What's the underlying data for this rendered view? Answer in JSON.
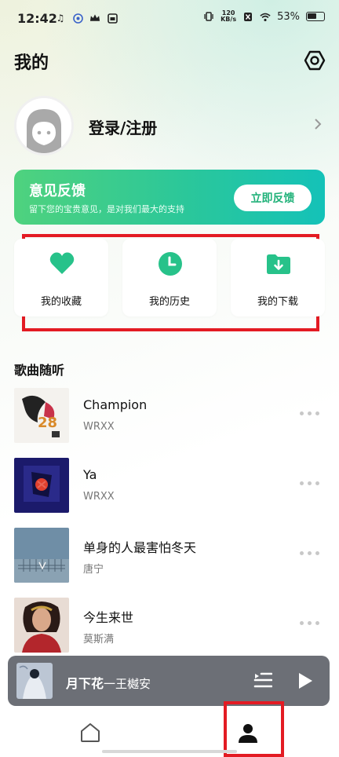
{
  "status_bar": {
    "time": "12:42",
    "net_speed_value": "120",
    "net_speed_unit": "KB/s",
    "battery": "53%",
    "icons_left": [
      "music-note-icon",
      "app-notification-icon",
      "crown-icon",
      "gallery-icon"
    ],
    "icons_right": [
      "vibrate-icon",
      "net-speed-icon",
      "no-sim-icon",
      "wifi-icon",
      "battery-icon"
    ]
  },
  "header": {
    "title": "我的",
    "settings_icon": "gear-icon"
  },
  "profile": {
    "login_label": "登录/注册"
  },
  "feedback": {
    "title": "意见反馈",
    "subtitle": "留下您的宝贵意见，是对我们最大的支持",
    "button_label": "立即反馈"
  },
  "quick_actions": [
    {
      "label": "我的收藏",
      "icon": "heart-icon"
    },
    {
      "label": "我的历史",
      "icon": "clock-icon"
    },
    {
      "label": "我的下载",
      "icon": "download-folder-icon"
    }
  ],
  "songs_section": {
    "title": "歌曲随听",
    "songs": [
      {
        "title": "Champion",
        "artist": "WRXX"
      },
      {
        "title": "Ya",
        "artist": "WRXX"
      },
      {
        "title": "单身的人最害怕冬天",
        "artist": "唐宁"
      },
      {
        "title": "今生来世",
        "artist": "莫斯满"
      }
    ]
  },
  "mini_player": {
    "title": "月下花",
    "artist": "一王樾安"
  },
  "bottom_nav": {
    "items": [
      "home-icon",
      "profile-icon"
    ]
  },
  "colors": {
    "accent_green": "#22b27a",
    "banner_start": "#4fd27e",
    "banner_end": "#14c2b8",
    "highlight_red": "#e31b23",
    "player_bg": "#6c6f76"
  }
}
